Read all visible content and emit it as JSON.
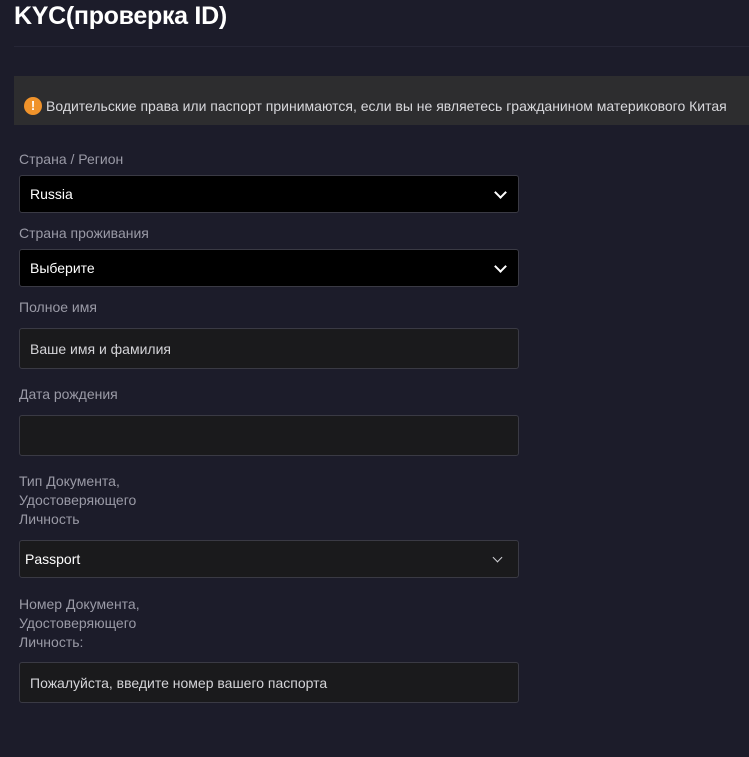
{
  "page": {
    "title": "KYC(проверка ID)"
  },
  "notice": {
    "icon": "warning-icon",
    "icon_glyph": "!",
    "icon_color": "#f0932b",
    "text": "Водительские права или паспорт принимаются, если вы не являетесь гражданином материкового Китая"
  },
  "form": {
    "country": {
      "label": "Страна / Регион",
      "value": "Russia"
    },
    "residence": {
      "label": "Страна проживания",
      "value": "Выберите"
    },
    "full_name": {
      "label": "Полное имя",
      "placeholder": "Ваше имя и фамилия",
      "value": ""
    },
    "birth_date": {
      "label": "Дата рождения",
      "value": ""
    },
    "document_type": {
      "label_lines": [
        "Тип Документа,",
        "Удостоверяющего",
        "Личность"
      ],
      "value": "Passport"
    },
    "document_number": {
      "label_lines": [
        "Номер Документа,",
        "Удостоверяющего",
        "Личность:"
      ],
      "placeholder": "Пожалуйста, введите номер вашего паспорта",
      "value": ""
    }
  }
}
